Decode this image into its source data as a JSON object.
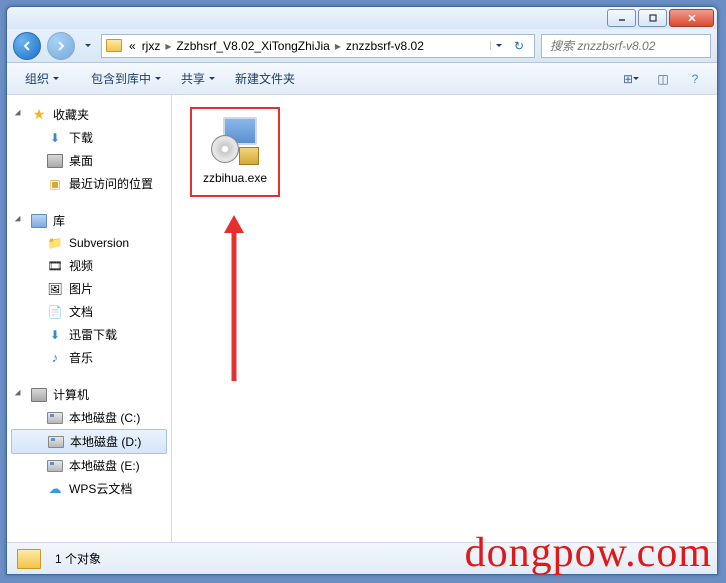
{
  "breadcrumb": {
    "prefix": "«",
    "items": [
      "rjxz",
      "Zzbhsrf_V8.02_XiTongZhiJia",
      "znzzbsrf-v8.02"
    ]
  },
  "search": {
    "placeholder": "搜索 znzzbsrf-v8.02"
  },
  "toolbar": {
    "organize": "组织",
    "include": "包含到库中",
    "share": "共享",
    "newfolder": "新建文件夹"
  },
  "sidebar": {
    "favorites": {
      "label": "收藏夹",
      "items": [
        "下载",
        "桌面",
        "最近访问的位置"
      ]
    },
    "libraries": {
      "label": "库",
      "items": [
        "Subversion",
        "视频",
        "图片",
        "文档",
        "迅雷下载",
        "音乐"
      ]
    },
    "computer": {
      "label": "计算机",
      "items": [
        "本地磁盘 (C:)",
        "本地磁盘 (D:)",
        "本地磁盘 (E:)",
        "WPS云文档"
      ],
      "selected": 1
    }
  },
  "files": [
    {
      "name": "zzbihua.exe"
    }
  ],
  "status": {
    "count": "1 个对象"
  },
  "watermark": "dongpow.com"
}
